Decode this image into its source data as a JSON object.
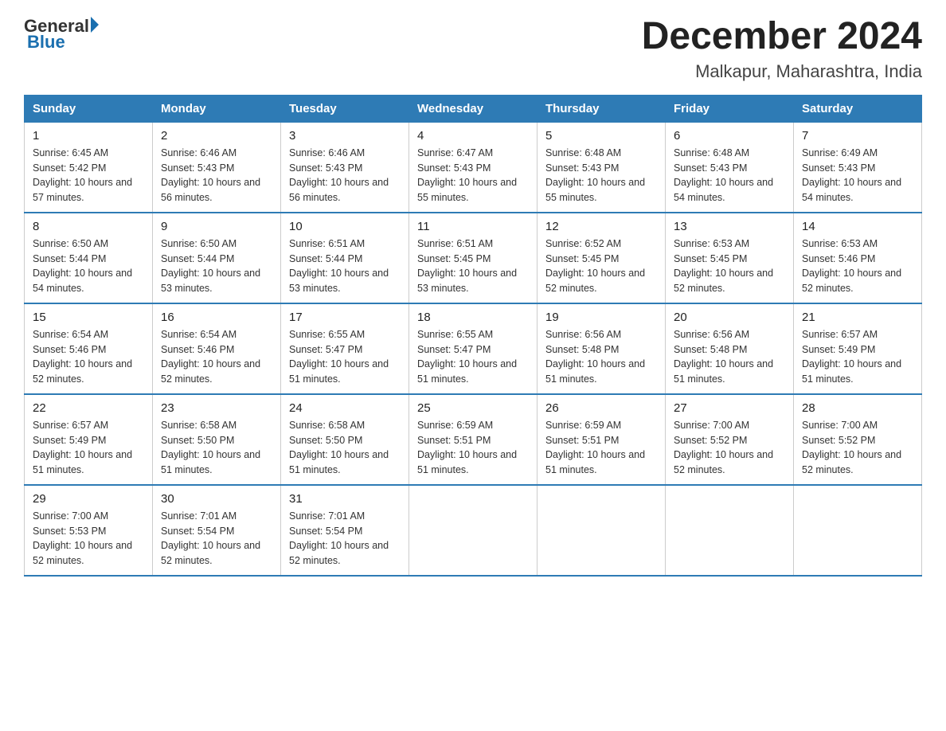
{
  "header": {
    "logo": {
      "general": "General",
      "blue": "Blue"
    },
    "title": "December 2024",
    "location": "Malkapur, Maharashtra, India"
  },
  "weekdays": [
    "Sunday",
    "Monday",
    "Tuesday",
    "Wednesday",
    "Thursday",
    "Friday",
    "Saturday"
  ],
  "weeks": [
    [
      {
        "day": "1",
        "sunrise": "6:45 AM",
        "sunset": "5:42 PM",
        "daylight": "10 hours and 57 minutes."
      },
      {
        "day": "2",
        "sunrise": "6:46 AM",
        "sunset": "5:43 PM",
        "daylight": "10 hours and 56 minutes."
      },
      {
        "day": "3",
        "sunrise": "6:46 AM",
        "sunset": "5:43 PM",
        "daylight": "10 hours and 56 minutes."
      },
      {
        "day": "4",
        "sunrise": "6:47 AM",
        "sunset": "5:43 PM",
        "daylight": "10 hours and 55 minutes."
      },
      {
        "day": "5",
        "sunrise": "6:48 AM",
        "sunset": "5:43 PM",
        "daylight": "10 hours and 55 minutes."
      },
      {
        "day": "6",
        "sunrise": "6:48 AM",
        "sunset": "5:43 PM",
        "daylight": "10 hours and 54 minutes."
      },
      {
        "day": "7",
        "sunrise": "6:49 AM",
        "sunset": "5:43 PM",
        "daylight": "10 hours and 54 minutes."
      }
    ],
    [
      {
        "day": "8",
        "sunrise": "6:50 AM",
        "sunset": "5:44 PM",
        "daylight": "10 hours and 54 minutes."
      },
      {
        "day": "9",
        "sunrise": "6:50 AM",
        "sunset": "5:44 PM",
        "daylight": "10 hours and 53 minutes."
      },
      {
        "day": "10",
        "sunrise": "6:51 AM",
        "sunset": "5:44 PM",
        "daylight": "10 hours and 53 minutes."
      },
      {
        "day": "11",
        "sunrise": "6:51 AM",
        "sunset": "5:45 PM",
        "daylight": "10 hours and 53 minutes."
      },
      {
        "day": "12",
        "sunrise": "6:52 AM",
        "sunset": "5:45 PM",
        "daylight": "10 hours and 52 minutes."
      },
      {
        "day": "13",
        "sunrise": "6:53 AM",
        "sunset": "5:45 PM",
        "daylight": "10 hours and 52 minutes."
      },
      {
        "day": "14",
        "sunrise": "6:53 AM",
        "sunset": "5:46 PM",
        "daylight": "10 hours and 52 minutes."
      }
    ],
    [
      {
        "day": "15",
        "sunrise": "6:54 AM",
        "sunset": "5:46 PM",
        "daylight": "10 hours and 52 minutes."
      },
      {
        "day": "16",
        "sunrise": "6:54 AM",
        "sunset": "5:46 PM",
        "daylight": "10 hours and 52 minutes."
      },
      {
        "day": "17",
        "sunrise": "6:55 AM",
        "sunset": "5:47 PM",
        "daylight": "10 hours and 51 minutes."
      },
      {
        "day": "18",
        "sunrise": "6:55 AM",
        "sunset": "5:47 PM",
        "daylight": "10 hours and 51 minutes."
      },
      {
        "day": "19",
        "sunrise": "6:56 AM",
        "sunset": "5:48 PM",
        "daylight": "10 hours and 51 minutes."
      },
      {
        "day": "20",
        "sunrise": "6:56 AM",
        "sunset": "5:48 PM",
        "daylight": "10 hours and 51 minutes."
      },
      {
        "day": "21",
        "sunrise": "6:57 AM",
        "sunset": "5:49 PM",
        "daylight": "10 hours and 51 minutes."
      }
    ],
    [
      {
        "day": "22",
        "sunrise": "6:57 AM",
        "sunset": "5:49 PM",
        "daylight": "10 hours and 51 minutes."
      },
      {
        "day": "23",
        "sunrise": "6:58 AM",
        "sunset": "5:50 PM",
        "daylight": "10 hours and 51 minutes."
      },
      {
        "day": "24",
        "sunrise": "6:58 AM",
        "sunset": "5:50 PM",
        "daylight": "10 hours and 51 minutes."
      },
      {
        "day": "25",
        "sunrise": "6:59 AM",
        "sunset": "5:51 PM",
        "daylight": "10 hours and 51 minutes."
      },
      {
        "day": "26",
        "sunrise": "6:59 AM",
        "sunset": "5:51 PM",
        "daylight": "10 hours and 51 minutes."
      },
      {
        "day": "27",
        "sunrise": "7:00 AM",
        "sunset": "5:52 PM",
        "daylight": "10 hours and 52 minutes."
      },
      {
        "day": "28",
        "sunrise": "7:00 AM",
        "sunset": "5:52 PM",
        "daylight": "10 hours and 52 minutes."
      }
    ],
    [
      {
        "day": "29",
        "sunrise": "7:00 AM",
        "sunset": "5:53 PM",
        "daylight": "10 hours and 52 minutes."
      },
      {
        "day": "30",
        "sunrise": "7:01 AM",
        "sunset": "5:54 PM",
        "daylight": "10 hours and 52 minutes."
      },
      {
        "day": "31",
        "sunrise": "7:01 AM",
        "sunset": "5:54 PM",
        "daylight": "10 hours and 52 minutes."
      },
      null,
      null,
      null,
      null
    ]
  ]
}
